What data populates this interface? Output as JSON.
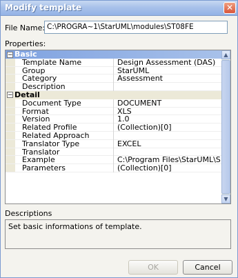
{
  "window": {
    "title": "Modify template",
    "close_glyph": "✕"
  },
  "file": {
    "label": "File Name:",
    "value": "C:\\PROGRA~1\\StarUML\\modules\\ST08FE"
  },
  "properties_label": "Properties:",
  "grid": {
    "categories": [
      {
        "name": "Basic",
        "toggle": "−",
        "rows": [
          {
            "name": "Template Name",
            "value": "Design Assessment (DAS)"
          },
          {
            "name": "Group",
            "value": "StarUML"
          },
          {
            "name": "Category",
            "value": "Assessment"
          },
          {
            "name": "Description",
            "value": ""
          }
        ]
      },
      {
        "name": "Detail",
        "toggle": "−",
        "rows": [
          {
            "name": "Document Type",
            "value": "DOCUMENT"
          },
          {
            "name": "Format",
            "value": "XLS"
          },
          {
            "name": "Version",
            "value": "1.0"
          },
          {
            "name": "Related Profile",
            "value": "(Collection)[0]"
          },
          {
            "name": "Related Approach",
            "value": ""
          },
          {
            "name": "Translator Type",
            "value": "EXCEL"
          },
          {
            "name": "Translator",
            "value": ""
          },
          {
            "name": "Example",
            "value": "C:\\Program Files\\StarUML\\S"
          },
          {
            "name": "Parameters",
            "value": "(Collection)[0]"
          }
        ]
      }
    ],
    "scroll_up_glyph": "▲",
    "scroll_down_glyph": "▼"
  },
  "descriptions": {
    "label": "Descriptions",
    "text": "Set basic informations of template."
  },
  "buttons": {
    "ok": "OK",
    "cancel": "Cancel"
  }
}
